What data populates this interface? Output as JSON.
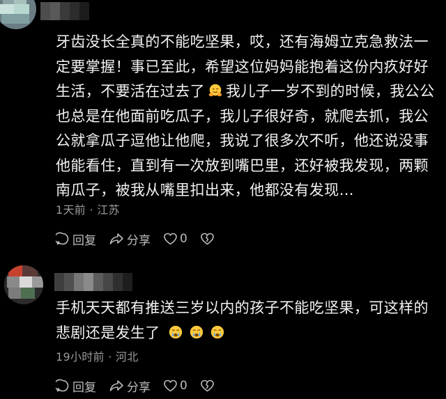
{
  "comments": [
    {
      "text_a": "牙齿没长全真的不能吃坚果，哎，还有海姆立克急救法一定要掌握！事已至此，希望这位妈妈能抱着这份内疚好好生活，不要活在过去了",
      "emoji_a": "hugging-face-emoji",
      "text_b": "我儿子一岁不到的时候，我公公也总是在他面前吃瓜子，我儿子很好奇，就爬去抓，我公公就拿瓜子逗他让他爬，我说了很多次不听，他还说没事他能看住，直到有一次放到嘴巴里，还好被我发现，两颗南瓜子，被我从嘴里扣出来，他都没有发现…",
      "meta": "1天前 · 江苏",
      "reply_label": "回复",
      "share_label": "分享",
      "like_count": "0",
      "dislike_label": ""
    },
    {
      "text": "手机天天都有推送三岁以内的孩子不能吃坚果，可这样的悲剧还是发生了",
      "emojis": [
        "crying-face-emoji",
        "crying-face-emoji",
        "crying-face-emoji"
      ],
      "meta": "19小时前 · 河北",
      "reply_label": "回复",
      "share_label": "分享",
      "like_count": "0",
      "dislike_label": ""
    }
  ],
  "colors": {
    "background": "#000000",
    "text": "#f2f2f2",
    "meta": "#9a9a9a",
    "action": "#bdbdbd",
    "emoji_yellow": "#ffc93c",
    "emoji_tear": "#5aa9ff"
  }
}
